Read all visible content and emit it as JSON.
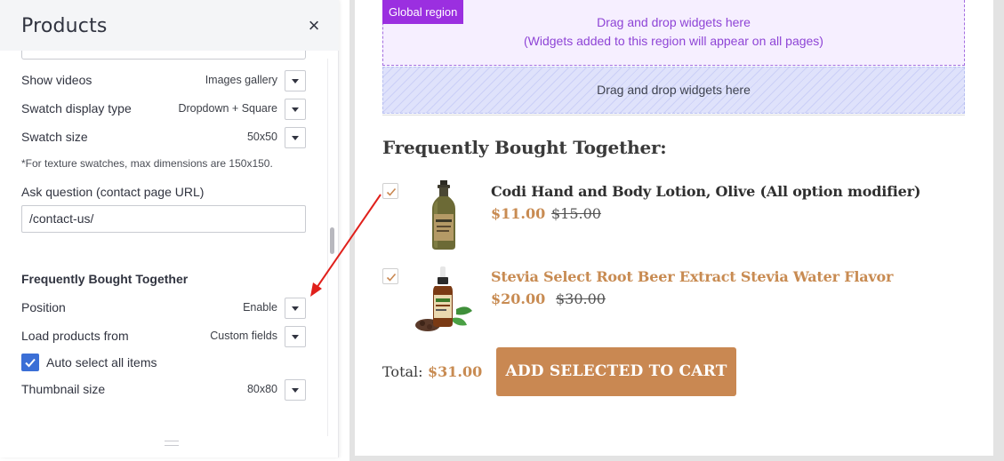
{
  "panel": {
    "title": "Products",
    "close_glyph": "×",
    "rows_top": [
      {
        "label": "Show videos",
        "value": "Images gallery"
      },
      {
        "label": "Swatch display type",
        "value": "Dropdown + Square"
      },
      {
        "label": "Swatch size",
        "value": "50x50"
      }
    ],
    "note": "*For texture swatches, max dimensions are 150x150.",
    "ask_question": {
      "label": "Ask question (contact page URL)",
      "value": "/contact-us/"
    },
    "fbt_section": {
      "title": "Frequently Bought Together",
      "position": {
        "label": "Position",
        "value": "Enable"
      },
      "load_from": {
        "label": "Load products from",
        "value": "Custom fields"
      },
      "auto_select": {
        "label": "Auto select all items",
        "checked": true
      },
      "thumbnail": {
        "label": "Thumbnail size",
        "value": "80x80"
      }
    }
  },
  "preview": {
    "global_region": {
      "tag": "Global region",
      "line1": "Drag and drop widgets here",
      "line2": "(Widgets added to this region will appear on all pages)"
    },
    "drop_region": {
      "text": "Drag and drop widgets here"
    },
    "fbt": {
      "title": "Frequently Bought Together:",
      "items": [
        {
          "name": "Codi Hand and Body Lotion, Olive (All option modifier)",
          "price": "$11.00",
          "old_price": "$15.00",
          "checked": true,
          "name_color": "#2f2f2f"
        },
        {
          "name": "Stevia Select Root Beer Extract Stevia Water Flavor",
          "price": "$20.00",
          "old_price": "$30.00",
          "checked": true,
          "name_color": "#c88b52"
        }
      ],
      "total_label": "Total:",
      "total_value": "$31.00",
      "add_button": "ADD SELECTED TO CART"
    }
  },
  "colors": {
    "accent": "#c98852",
    "checkbox_blue": "#3b6fd6",
    "global_purple": "#9b2fe0",
    "annotation_arrow": "#e0201b"
  }
}
